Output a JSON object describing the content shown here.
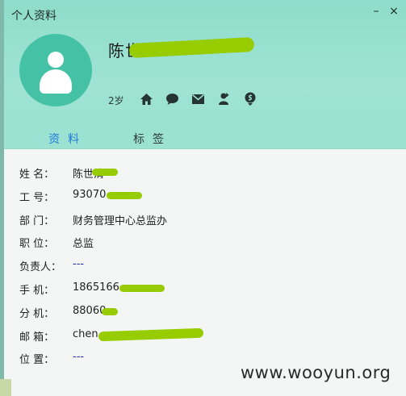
{
  "window": {
    "title": "个人资料",
    "min_symbol": "–",
    "close_symbol": "×"
  },
  "profile": {
    "display_name": "陈世",
    "age": "2岁",
    "action_icons": [
      "home-icon",
      "chat-icon",
      "mail-icon",
      "add-contact-icon",
      "location-icon"
    ]
  },
  "tabs": [
    {
      "label": "资料",
      "active": true
    },
    {
      "label": "标签",
      "active": false
    }
  ],
  "details": [
    {
      "label": "姓    名：",
      "value": "陈世清"
    },
    {
      "label": "工    号：",
      "value": "93070"
    },
    {
      "label": "部    门：",
      "value": "财务管理中心总监办"
    },
    {
      "label": "职    位：",
      "value": "总监"
    },
    {
      "label": "负责人：",
      "value": "---"
    },
    {
      "label": "手    机：",
      "value": "1865166"
    },
    {
      "label": "分    机：",
      "value": "88060"
    },
    {
      "label": "邮    箱：",
      "value": "chen"
    },
    {
      "label": "位    置：",
      "value": "---"
    }
  ],
  "watermark": "www.wooyun.org",
  "colors": {
    "header": "#9ee3d3",
    "avatar": "#45c2a5",
    "active_tab": "#1f79d6",
    "redaction": "#97cc00"
  }
}
